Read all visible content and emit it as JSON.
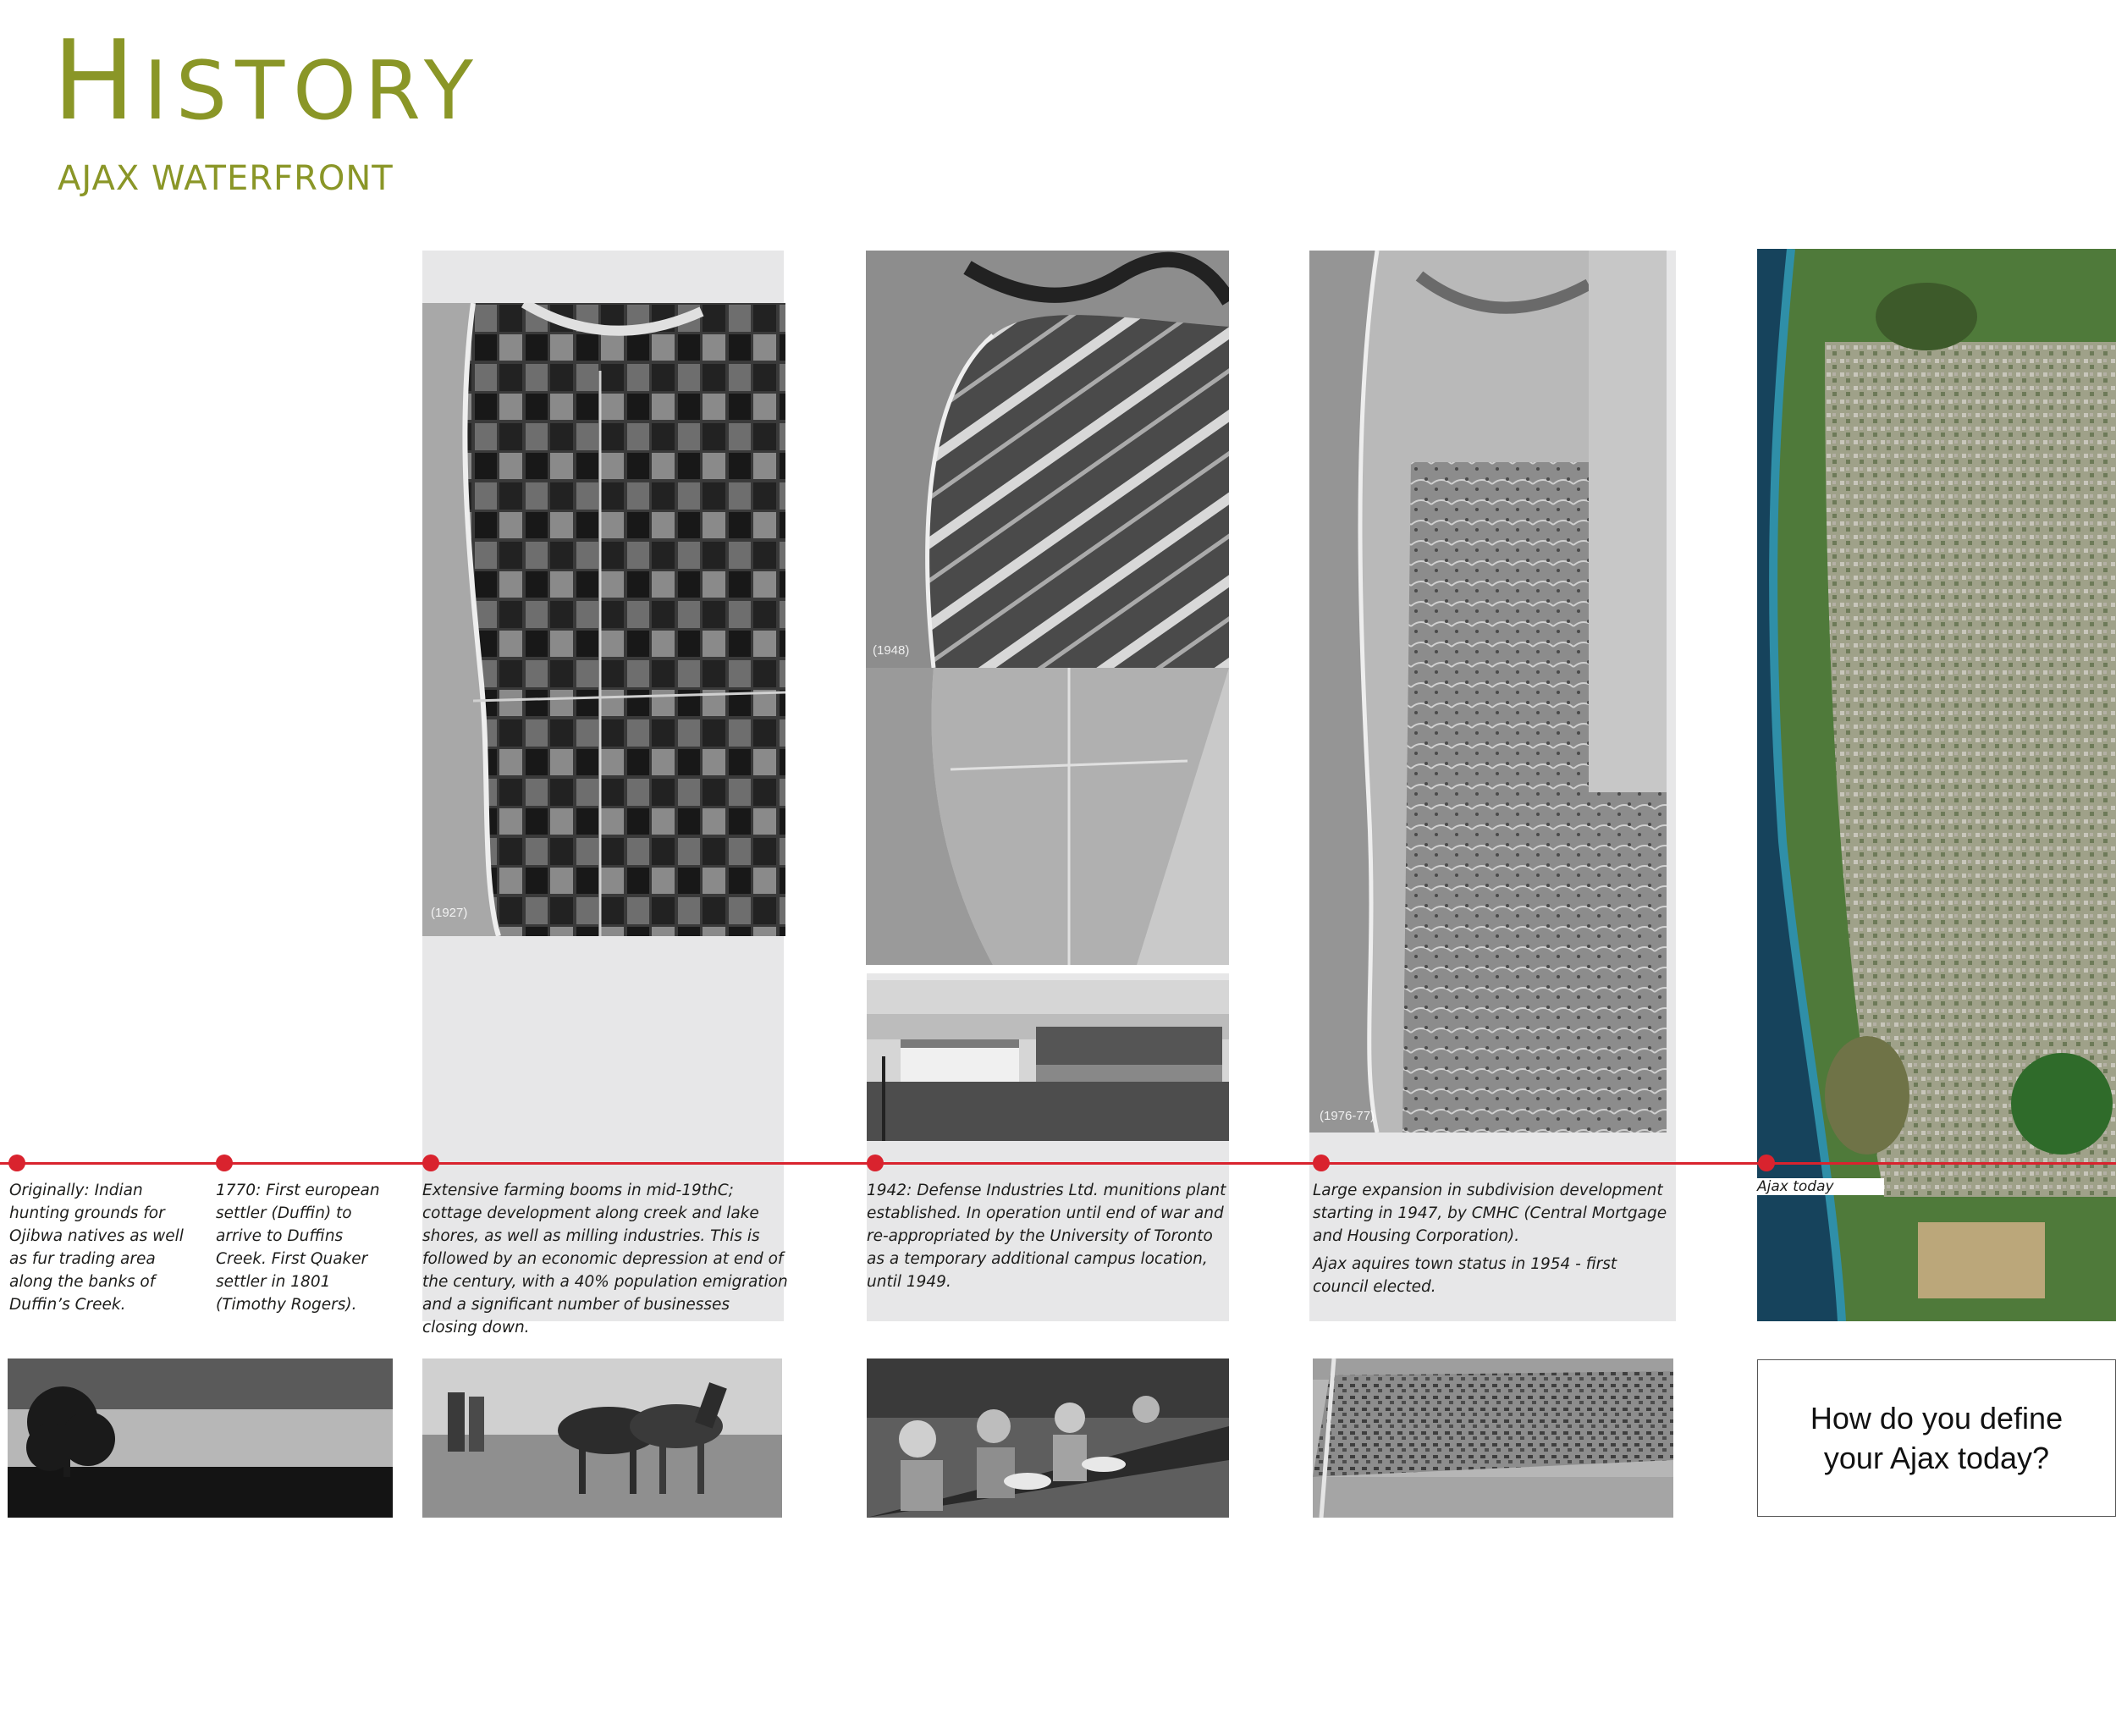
{
  "header": {
    "title_first": "H",
    "title_rest": "ISTORY",
    "subtitle": "AJAX WATERFRONT"
  },
  "photos": {
    "p1927_label": "(1927)",
    "p1948_label": "(1948)",
    "p1976_label": "(1976-77)"
  },
  "timeline": [
    {
      "caption": [
        "Originally: Indian hunting grounds for Ojibwa natives as well as fur trading area along the banks of Duffin’s Creek."
      ]
    },
    {
      "caption": [
        "1770: First european settler (Duffin) to arrive to Duffins Creek. First Quaker settler in 1801 (Timothy Rogers)."
      ]
    },
    {
      "caption": [
        "Extensive farming booms in mid-19thC; cottage development along creek and lake shores, as well as milling industries. This is followed by an economic depression at end of the century, with a 40% population emigration and a significant number of businesses closing down."
      ]
    },
    {
      "caption": [
        "1942: Defense Industries Ltd. munitions plant established. In operation until end of war and re-appropriated by the University of Toronto as a temporary additional campus location, until 1949."
      ]
    },
    {
      "caption": [
        "Large expansion in subdivision development starting in 1947, by CMHC (Central Mortgage and Housing Corporation).",
        "Ajax aquires town status in 1954 - first council elected."
      ]
    },
    {
      "caption": [
        "Ajax today"
      ]
    }
  ],
  "question": "How do you define your Ajax today?",
  "colors": {
    "accent_green": "#8a9627",
    "timeline_red": "#d9232e",
    "panel_grey": "#e7e7e8"
  }
}
